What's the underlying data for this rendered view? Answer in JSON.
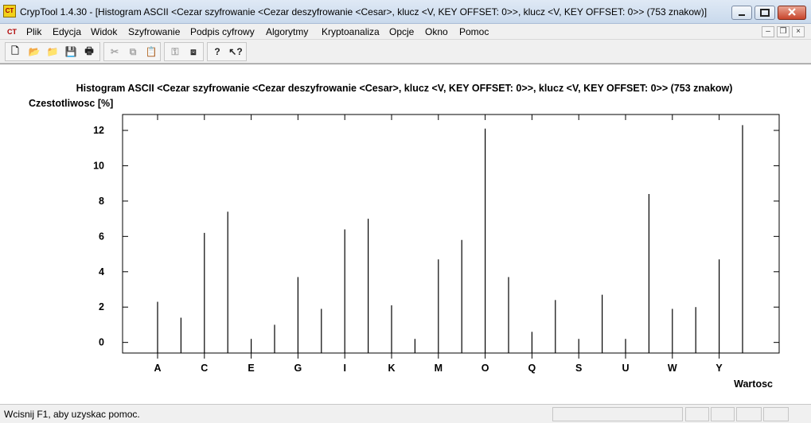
{
  "window": {
    "title": "CrypTool 1.4.30 - [Histogram ASCII <Cezar szyfrowanie <Cezar deszyfrowanie <Cesar>, klucz <V, KEY OFFSET: 0>>, klucz <V, KEY OFFSET: 0>> (753 znakow)]",
    "app_icon_text": "CT"
  },
  "menu": {
    "items": [
      "Plik",
      "Edycja",
      "Widok",
      "Szyfrowanie",
      "Podpis cyfrowy",
      "Algorytmy",
      "Kryptoanaliza",
      "Opcje",
      "Okno",
      "Pomoc"
    ]
  },
  "toolbar": {
    "buttons": [
      {
        "name": "new-icon",
        "glyph": "🗋",
        "enabled": true
      },
      {
        "name": "open-icon",
        "glyph": "📂",
        "enabled": true
      },
      {
        "name": "open-folder-icon",
        "glyph": "📁",
        "enabled": true
      },
      {
        "name": "save-icon",
        "glyph": "💾",
        "enabled": true
      },
      {
        "name": "print-icon",
        "glyph": "🖶",
        "enabled": true
      },
      {
        "name": "cut-icon",
        "glyph": "✂",
        "enabled": false
      },
      {
        "name": "copy-icon",
        "glyph": "⧉",
        "enabled": false
      },
      {
        "name": "paste-icon",
        "glyph": "📋",
        "enabled": false
      },
      {
        "name": "key-icon",
        "glyph": "⚿",
        "enabled": false
      },
      {
        "name": "window-icon",
        "glyph": "⧈",
        "enabled": true
      },
      {
        "name": "help-icon",
        "glyph": "?",
        "enabled": true
      },
      {
        "name": "context-help-icon",
        "glyph": "↖?",
        "enabled": true
      }
    ]
  },
  "chart_data": {
    "type": "bar",
    "title": "Histogram ASCII <Cezar szyfrowanie <Cezar deszyfrowanie <Cesar>, klucz <V, KEY OFFSET: 0>>, klucz <V, KEY OFFSET: 0>> (753 znakow)",
    "ylabel": "Czestotliwosc [%]",
    "xlabel": "Wartosc",
    "categories": [
      "A",
      "B",
      "C",
      "D",
      "E",
      "F",
      "G",
      "H",
      "I",
      "J",
      "K",
      "L",
      "M",
      "N",
      "O",
      "P",
      "Q",
      "R",
      "S",
      "T",
      "U",
      "V",
      "W",
      "X",
      "Y",
      "Z"
    ],
    "tick_labels": [
      "A",
      "C",
      "E",
      "G",
      "I",
      "K",
      "M",
      "O",
      "Q",
      "S",
      "U",
      "W",
      "Y"
    ],
    "values": [
      2.3,
      1.4,
      6.2,
      7.4,
      0.2,
      1.0,
      3.7,
      1.9,
      6.4,
      7.0,
      2.1,
      0.2,
      4.7,
      5.8,
      12.1,
      3.7,
      0.6,
      2.4,
      0.2,
      2.7,
      0.2,
      8.4,
      1.9,
      2.0,
      4.7,
      12.3
    ],
    "ylim": [
      -0.6,
      12.9
    ],
    "yticks": [
      0,
      2,
      4,
      6,
      8,
      10,
      12
    ],
    "grid": false
  },
  "status": {
    "text": "Wcisnij F1, aby uzyskac pomoc."
  }
}
